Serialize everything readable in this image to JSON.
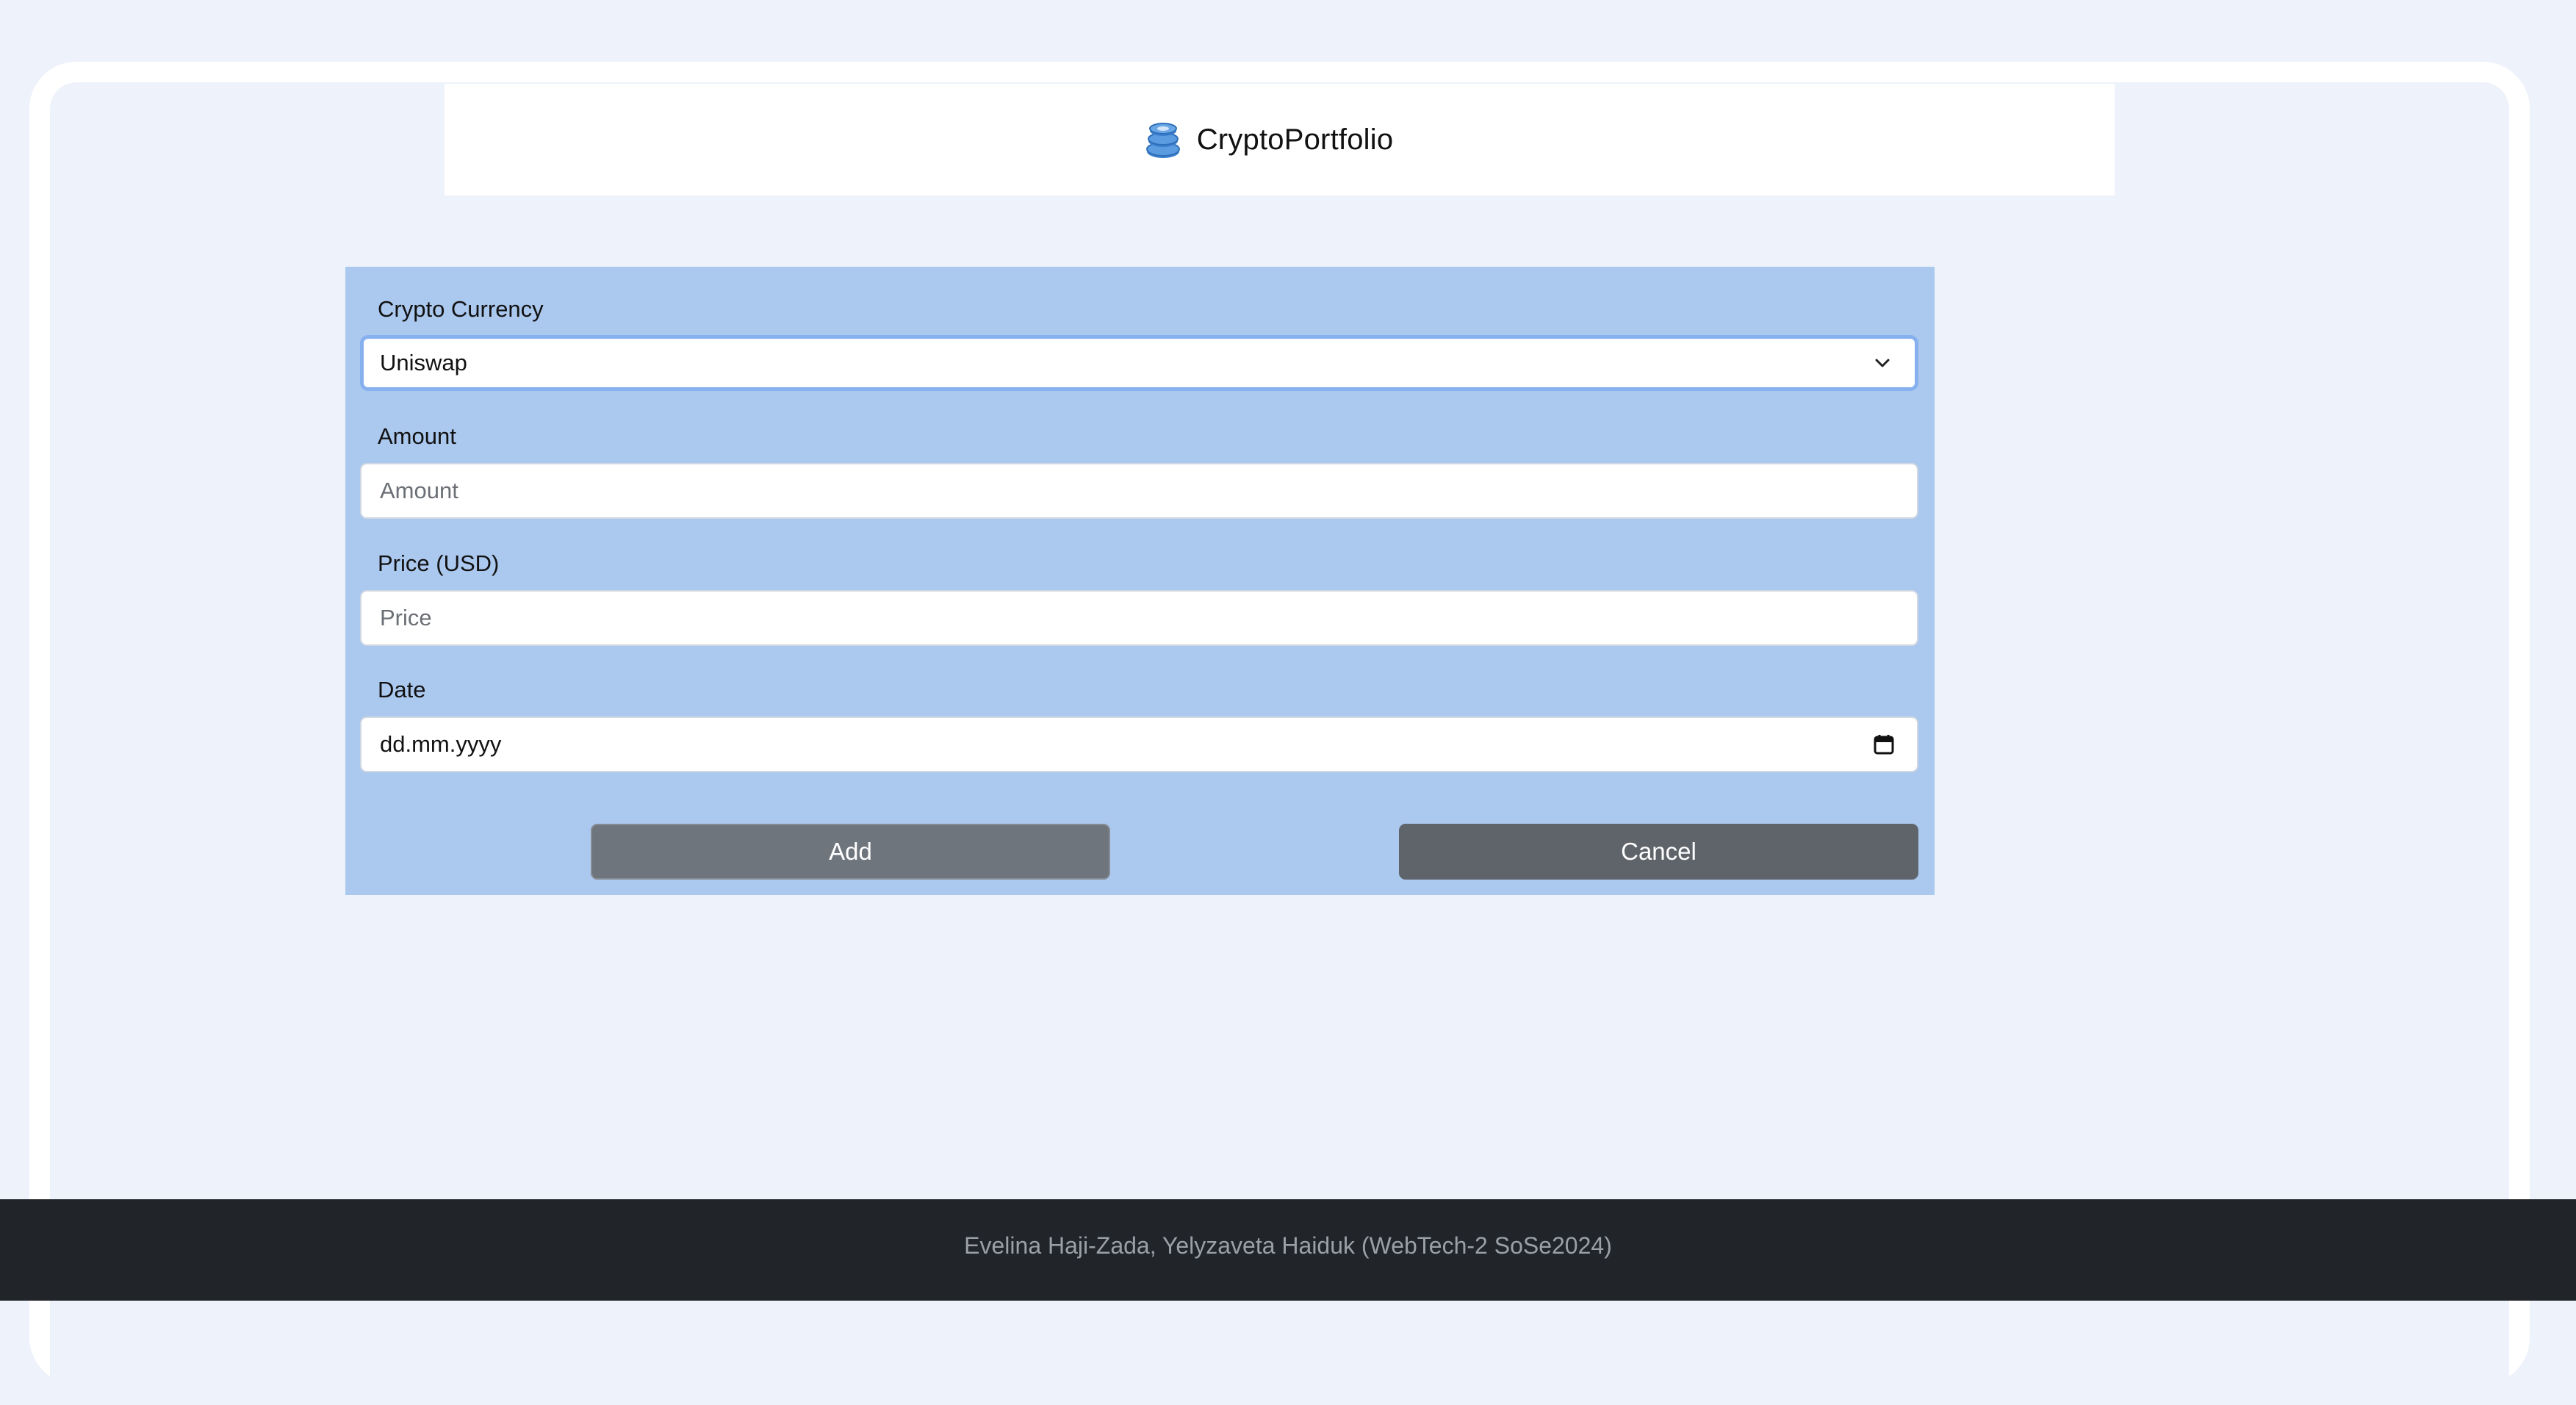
{
  "header": {
    "title": "CryptoPortfolio",
    "logo_icon": "coins-stack-icon"
  },
  "form": {
    "currency": {
      "label": "Crypto Currency",
      "selected": "Uniswap"
    },
    "amount": {
      "label": "Amount",
      "placeholder": "Amount",
      "value": ""
    },
    "price": {
      "label": "Price (USD)",
      "placeholder": "Price",
      "value": ""
    },
    "date": {
      "label": "Date",
      "placeholder": "dd.mm.yyyy"
    },
    "buttons": {
      "add": "Add",
      "cancel": "Cancel"
    }
  },
  "footer": {
    "text": "Evelina Haji-Zada, Yelyzaveta Haiduk (WebTech-2 SoSe2024)"
  },
  "colors": {
    "page_bg": "#eef2fa",
    "form_bg": "#abc8ee",
    "focus_ring": "#86b0ee",
    "add_button": "#6f757d",
    "cancel_button": "#5f646b",
    "footer_bg": "#212529",
    "brand_icon": "#3b7fd0"
  }
}
